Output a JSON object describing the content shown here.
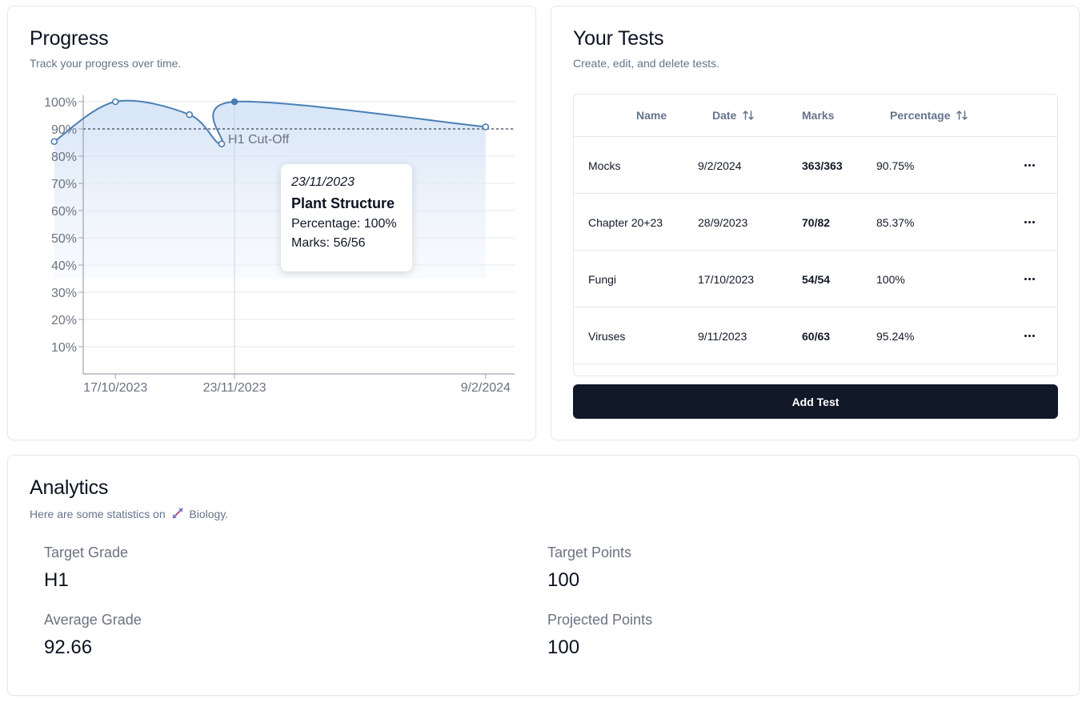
{
  "progress": {
    "title": "Progress",
    "description": "Track your progress over time.",
    "cutoff_label": "H1 Cut-Off",
    "tooltip": {
      "date": "23/11/2023",
      "name": "Plant Structure",
      "percentage_line": "Percentage: 100%",
      "marks_line": "Marks: 56/56"
    }
  },
  "chart_data": {
    "type": "area",
    "title": "",
    "xlabel": "",
    "ylabel": "",
    "x_ticks": [
      "17/10/2023",
      "23/11/2023",
      "9/2/2024"
    ],
    "y_ticks": [
      "10%",
      "20%",
      "30%",
      "40%",
      "50%",
      "60%",
      "70%",
      "80%",
      "90%",
      "100%"
    ],
    "ylim": [
      0,
      100
    ],
    "xlim": [
      "7/10/2023",
      "18/2/2024"
    ],
    "points": [
      {
        "x": "28/9/2023",
        "y": 85.37
      },
      {
        "x": "17/10/2023",
        "y": 100
      },
      {
        "x": "9/11/2023",
        "y": 95.24
      },
      {
        "x": "19/11/2023",
        "y": 84.5
      },
      {
        "x": "23/11/2023",
        "y": 100
      },
      {
        "x": "9/2/2024",
        "y": 90.75
      }
    ],
    "active_point": "23/11/2023",
    "reference_line": {
      "y": 90,
      "label": "H1 Cut-Off"
    },
    "grid": true,
    "colors": {
      "line": "#4a7fb5",
      "fill": "#dbe8f8",
      "grid": "#e5e7eb",
      "reference": "#374151"
    }
  },
  "tests": {
    "title": "Your Tests",
    "description": "Create, edit, and delete tests.",
    "columns": {
      "name": "Name",
      "date": "Date",
      "marks": "Marks",
      "percentage": "Percentage"
    },
    "rows": [
      {
        "name": "Mocks",
        "date": "9/2/2024",
        "marks": "363/363",
        "percentage": "90.75%"
      },
      {
        "name": "Chapter 20+23",
        "date": "28/9/2023",
        "marks": "70/82",
        "percentage": "85.37%"
      },
      {
        "name": "Fungi",
        "date": "17/10/2023",
        "marks": "54/54",
        "percentage": "100%"
      },
      {
        "name": "Viruses",
        "date": "9/11/2023",
        "marks": "60/63",
        "percentage": "95.24%"
      }
    ],
    "add_label": "Add Test"
  },
  "analytics": {
    "title": "Analytics",
    "description_prefix": "Here are some statistics on",
    "subject_icon": "dna-icon",
    "subject": "Biology.",
    "target_grade_label": "Target Grade",
    "target_grade": "H1",
    "average_grade_label": "Average Grade",
    "average_grade": "92.66",
    "target_points_label": "Target Points",
    "target_points": "100",
    "projected_points_label": "Projected Points",
    "projected_points": "100"
  }
}
